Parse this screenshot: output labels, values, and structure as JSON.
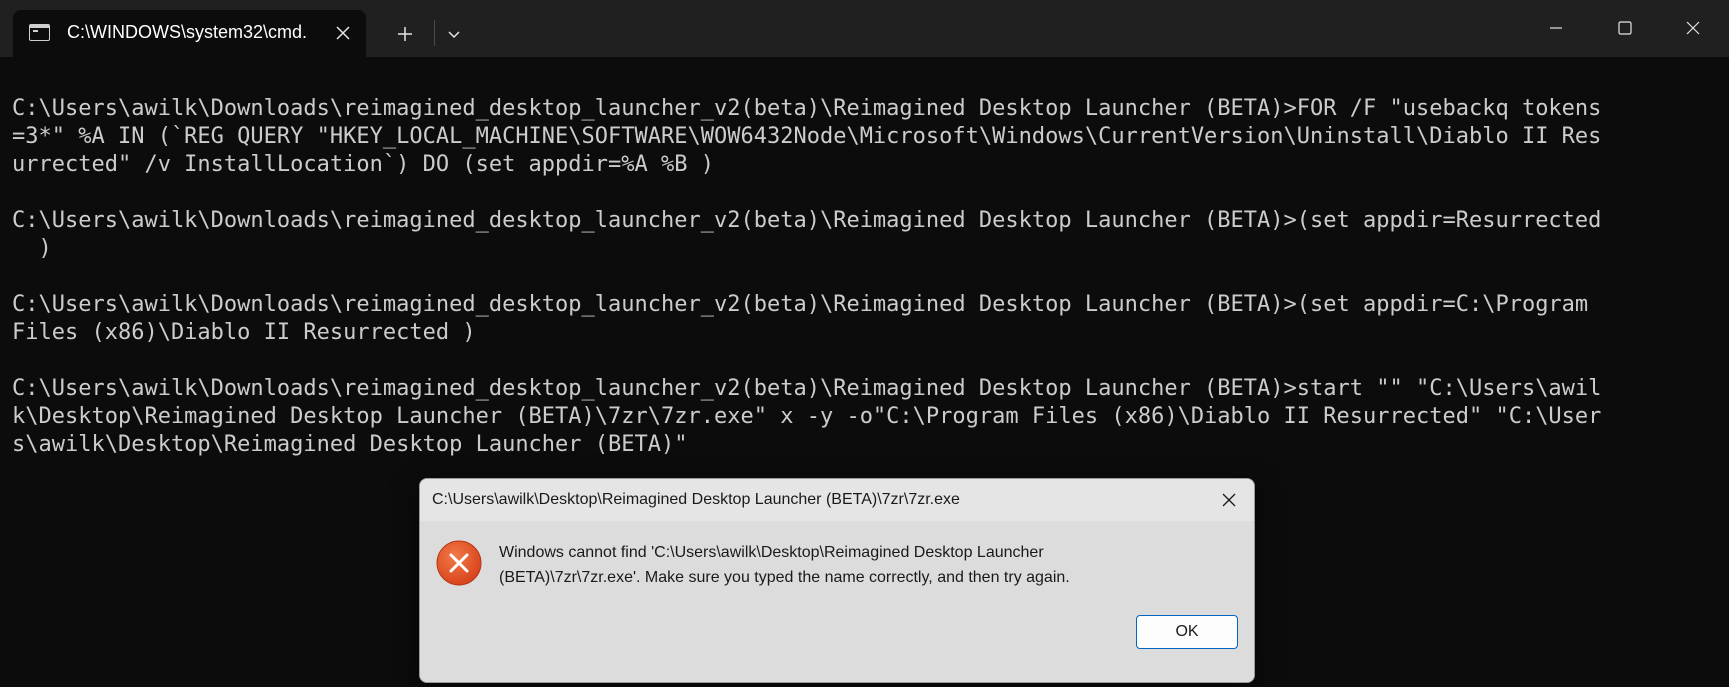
{
  "window": {
    "tab_title": "C:\\WINDOWS\\system32\\cmd.",
    "icons": {
      "tab": "terminal-icon",
      "tab_close": "close-icon",
      "new_tab": "plus-icon",
      "dropdown": "chevron-down-icon",
      "minimize": "minimize-icon",
      "maximize": "maximize-icon",
      "close": "close-icon"
    }
  },
  "terminal": {
    "text_color": "#cccccc",
    "background": "#0c0c0c",
    "lines": [
      "C:\\Users\\awilk\\Downloads\\reimagined_desktop_launcher_v2(beta)\\Reimagined Desktop Launcher (BETA)>FOR /F \"usebackq tokens",
      "=3*\" %A IN (`REG QUERY \"HKEY_LOCAL_MACHINE\\SOFTWARE\\WOW6432Node\\Microsoft\\Windows\\CurrentVersion\\Uninstall\\Diablo II Res",
      "urrected\" /v InstallLocation`) DO (set appdir=%A %B )",
      "C:\\Users\\awilk\\Downloads\\reimagined_desktop_launcher_v2(beta)\\Reimagined Desktop Launcher (BETA)>(set appdir=Resurrected",
      "  )",
      "C:\\Users\\awilk\\Downloads\\reimagined_desktop_launcher_v2(beta)\\Reimagined Desktop Launcher (BETA)>(set appdir=C:\\Program",
      "Files (x86)\\Diablo II Resurrected )",
      "C:\\Users\\awilk\\Downloads\\reimagined_desktop_launcher_v2(beta)\\Reimagined Desktop Launcher (BETA)>start \"\" \"C:\\Users\\awil",
      "k\\Desktop\\Reimagined Desktop Launcher (BETA)\\7zr\\7zr.exe\" x -y -o\"C:\\Program Files (x86)\\Diablo II Resurrected\" \"C:\\User",
      "s\\awilk\\Desktop\\Reimagined Desktop Launcher (BETA)\""
    ]
  },
  "dialog": {
    "title": "C:\\Users\\awilk\\Desktop\\Reimagined Desktop Launcher (BETA)\\7zr\\7zr.exe",
    "message": "Windows cannot find 'C:\\Users\\awilk\\Desktop\\Reimagined Desktop Launcher (BETA)\\7zr\\7zr.exe'. Make sure you typed the name correctly, and then try again.",
    "ok_label": "OK",
    "icon": "error-icon",
    "error_color": "#e8562a",
    "accent_color": "#0067c0"
  }
}
